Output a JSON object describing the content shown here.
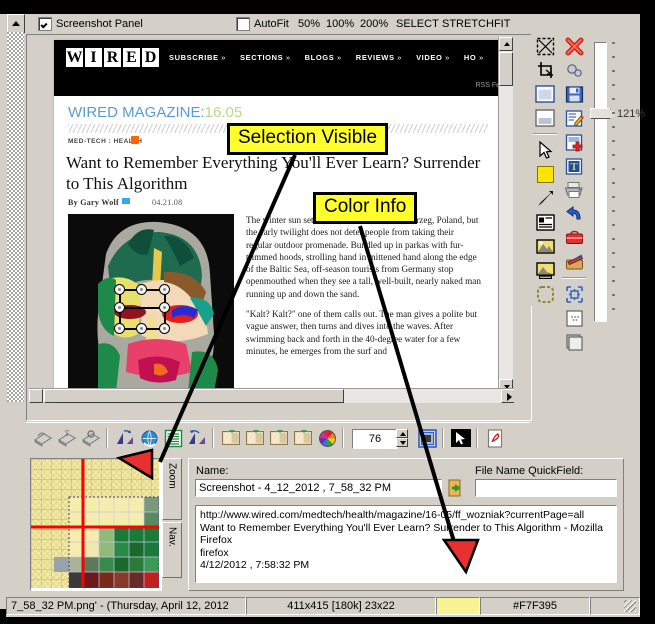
{
  "window": {
    "title_bar_absent": true
  },
  "toolbar_top": {
    "screenshot_panel_label": "Screenshot Panel",
    "screenshot_panel_checked": true,
    "autofit_label": "AutoFit",
    "autofit_checked": false,
    "zoom_presets": [
      "50%",
      "100%",
      "200%",
      "SELECT",
      "STRETCHFIT"
    ]
  },
  "zoom_slider": {
    "value_label": "121%"
  },
  "right_toolbar_col1": [
    {
      "name": "select-all-icon",
      "glyph": "⊠"
    },
    {
      "name": "crop-icon",
      "glyph": "⌗"
    },
    {
      "name": "window-full-icon",
      "glyph": "▣"
    },
    {
      "name": "window-half-icon",
      "glyph": "▤"
    },
    {
      "name": "pointer-tool-icon",
      "glyph": "➤"
    },
    {
      "name": "color-swatch-icon",
      "glyph": "■"
    },
    {
      "name": "arrow-tool-icon",
      "glyph": "↗"
    },
    {
      "name": "text-block-icon",
      "glyph": "▤"
    },
    {
      "name": "image-icon",
      "glyph": "▥"
    },
    {
      "name": "image-resize-icon",
      "glyph": "▥"
    },
    {
      "name": "selection-dashed-icon",
      "glyph": "▢"
    }
  ],
  "right_toolbar_col2": [
    {
      "name": "close-red-x-icon",
      "glyph": "✖"
    },
    {
      "name": "settings-gears-icon",
      "glyph": "⚙"
    },
    {
      "name": "save-disk-icon",
      "glyph": "💾"
    },
    {
      "name": "edit-pencil-icon",
      "glyph": "✎"
    },
    {
      "name": "add-page-icon",
      "glyph": "✚"
    },
    {
      "name": "text-tool-icon",
      "glyph": "T"
    },
    {
      "name": "print-icon",
      "glyph": "🖶"
    },
    {
      "name": "undo-icon",
      "glyph": "↺"
    },
    {
      "name": "toolbox-icon",
      "glyph": "🧰"
    },
    {
      "name": "paintbox-icon",
      "glyph": "🎨"
    },
    {
      "name": "resize-canvas-icon",
      "glyph": "⤢"
    },
    {
      "name": "dotted-square-icon",
      "glyph": "⬚"
    },
    {
      "name": "new-window-icon",
      "glyph": "▢"
    }
  ],
  "mid_toolbar": {
    "icons": [
      {
        "name": "scan-icon"
      },
      {
        "name": "scan-text-icon"
      },
      {
        "name": "scan-object-icon"
      },
      {
        "name": "flip-horizontal-icon"
      },
      {
        "name": "globe-refresh-icon"
      },
      {
        "name": "text-lines-icon"
      },
      {
        "name": "flip-vertical-icon"
      },
      {
        "name": "image-copy-1-icon"
      },
      {
        "name": "image-copy-2-icon"
      },
      {
        "name": "image-copy-3-icon"
      },
      {
        "name": "image-copy-4-icon"
      },
      {
        "name": "color-wheel-icon"
      },
      {
        "name": "frame-icon"
      },
      {
        "name": "cursor-capture-icon"
      },
      {
        "name": "pdf-icon"
      }
    ],
    "quality_value": "76"
  },
  "nav_panel": {
    "tabs": [
      {
        "label": "Zoom",
        "active": true
      },
      {
        "label": "Nav.",
        "active": false
      }
    ]
  },
  "form": {
    "name_label": "Name:",
    "name_value": "Screenshot - 4_12_2012 , 7_58_32 PM",
    "quickfield_label": "File Name QuickField:",
    "quickfield_value": "",
    "quickfield_placeholder": "",
    "details_lines": [
      "http://www.wired.com/medtech/health/magazine/16-05/ff_wozniak?currentPage=all",
      "Want to Remember Everything You'll Ever Learn? Surrender to This Algorithm - Mozilla Firefox",
      "firefox",
      "4/12/2012 , 7:58:32 PM"
    ]
  },
  "status_bar": {
    "filename": "7_58_32 PM.png'  -  (Thursday, April 12, 2012",
    "dimensions": "411x415  [180k]  23x22",
    "color_swatch_hex": "#F7F395",
    "color_hex_label": "#F7F395"
  },
  "annotations": [
    {
      "name": "selection-visible-callout",
      "text": "Selection Visible"
    },
    {
      "name": "color-info-callout",
      "text": "Color Info"
    }
  ],
  "screenshot_content": {
    "site": "WIRED",
    "nav_items": [
      "SUBSCRIBE",
      "SECTIONS",
      "BLOGS",
      "REVIEWS",
      "VIDEO",
      "HO"
    ],
    "rss_text": "RSS Fe",
    "magazine_label": "WIRED MAGAZINE:",
    "magazine_issue": "16.05",
    "category": "MED-TECH : HEALTH",
    "headline": "Want to Remember Everything You'll Ever Learn? Surrender to This Algorithm",
    "byline": "By Gary Wolf",
    "date": "04.21.08",
    "paragraphs": [
      "The winter sun sets in mid-afternoon in Kolobrzeg, Poland, but the early twilight does not deter people from taking their regular outdoor promenade. Bundled up in parkas with fur-trimmed hoods, strolling hand in mittened hand along the edge of the Baltic Sea, off-season tourists from Germany stop openmouthed when they see a tall, well-built, nearly naked man running up and down the sand.",
      "\"Kalt? Kalt?\" one of them calls out. The man gives a polite but vague answer, then turns and dives into the waves. After swimming back and forth in the 40-degree water for a few minutes, he emerges from the surf and"
    ]
  },
  "colors": {
    "face": "#d4d0c8",
    "callout_yellow": "#ffff2e",
    "swatch": "#F7F395",
    "accent_red": "#e03030",
    "wired_blue": "#5b9bd5"
  }
}
